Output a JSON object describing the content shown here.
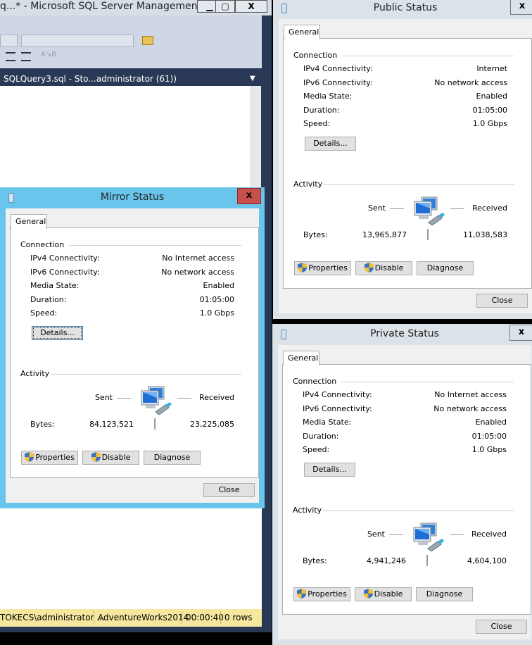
{
  "ssms": {
    "title": "q...* - Microsoft SQL Server Management ...",
    "document_tab": "SQLQuery3.sql - Sto...administrator (61))",
    "status": {
      "user": "TOKECS\\administrator ...",
      "database": "AdventureWorks2014",
      "elapsed": "00:00:40",
      "rows": "0 rows"
    },
    "status_color": "#f5e79e"
  },
  "dialogs": [
    {
      "id": "mirror",
      "title": "Mirror Status",
      "active": true,
      "tab": "General",
      "connection_label": "Connection",
      "rows": [
        {
          "label": "IPv4 Connectivity:",
          "value": "No Internet access"
        },
        {
          "label": "IPv6 Connectivity:",
          "value": "No network access"
        },
        {
          "label": "Media State:",
          "value": "Enabled"
        },
        {
          "label": "Duration:",
          "value": "01:05:00"
        },
        {
          "label": "Speed:",
          "value": "1.0 Gbps"
        }
      ],
      "details": "Details...",
      "activity_label": "Activity",
      "sent": "Sent",
      "received": "Received",
      "bytes_label": "Bytes:",
      "bytes_sent": "84,123,521",
      "bytes_received": "23,225,085",
      "properties": "Properties",
      "disable": "Disable",
      "diagnose": "Diagnose",
      "close": "Close",
      "close_x": "x"
    },
    {
      "id": "public",
      "title": "Public Status",
      "active": false,
      "tab": "General",
      "connection_label": "Connection",
      "rows": [
        {
          "label": "IPv4 Connectivity:",
          "value": "Internet"
        },
        {
          "label": "IPv6 Connectivity:",
          "value": "No network access"
        },
        {
          "label": "Media State:",
          "value": "Enabled"
        },
        {
          "label": "Duration:",
          "value": "01:05:00"
        },
        {
          "label": "Speed:",
          "value": "1.0 Gbps"
        }
      ],
      "details": "Details...",
      "activity_label": "Activity",
      "sent": "Sent",
      "received": "Received",
      "bytes_label": "Bytes:",
      "bytes_sent": "13,965,877",
      "bytes_received": "11,038,583",
      "properties": "Properties",
      "disable": "Disable",
      "diagnose": "Diagnose",
      "close": "Close",
      "close_x": "x"
    },
    {
      "id": "private",
      "title": "Private Status",
      "active": false,
      "tab": "General",
      "connection_label": "Connection",
      "rows": [
        {
          "label": "IPv4 Connectivity:",
          "value": "No Internet access"
        },
        {
          "label": "IPv6 Connectivity:",
          "value": "No network access"
        },
        {
          "label": "Media State:",
          "value": "Enabled"
        },
        {
          "label": "Duration:",
          "value": "01:05:00"
        },
        {
          "label": "Speed:",
          "value": "1.0 Gbps"
        }
      ],
      "details": "Details...",
      "activity_label": "Activity",
      "sent": "Sent",
      "received": "Received",
      "bytes_label": "Bytes:",
      "bytes_sent": "4,941,246",
      "bytes_received": "4,604,100",
      "properties": "Properties",
      "disable": "Disable",
      "diagnose": "Diagnose",
      "close": "Close",
      "close_x": "x"
    }
  ],
  "icons": {
    "network": "network-computers-icon",
    "shield": "uac-shield-icon",
    "adapter": "network-adapter-icon"
  },
  "colors": {
    "active_frame": "#69c5ec",
    "inactive_frame": "#dbe3e9",
    "close_active": "#c7514a",
    "ssms_navy": "#293955"
  }
}
